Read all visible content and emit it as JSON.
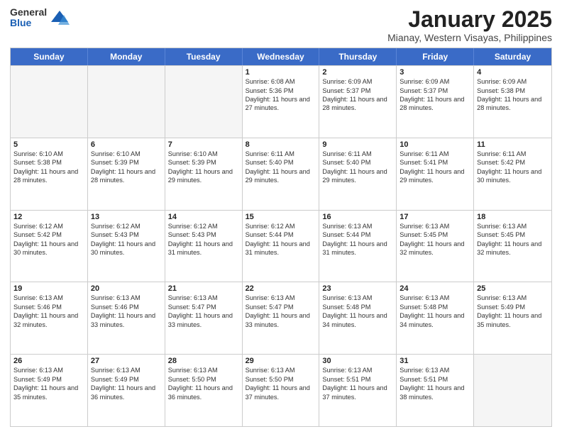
{
  "logo": {
    "general": "General",
    "blue": "Blue"
  },
  "header": {
    "month": "January 2025",
    "location": "Mianay, Western Visayas, Philippines"
  },
  "days": [
    "Sunday",
    "Monday",
    "Tuesday",
    "Wednesday",
    "Thursday",
    "Friday",
    "Saturday"
  ],
  "weeks": [
    [
      {
        "day": "",
        "empty": true
      },
      {
        "day": "",
        "empty": true
      },
      {
        "day": "",
        "empty": true
      },
      {
        "day": "1",
        "sunrise": "6:08 AM",
        "sunset": "5:36 PM",
        "daylight": "11 hours and 27 minutes."
      },
      {
        "day": "2",
        "sunrise": "6:09 AM",
        "sunset": "5:37 PM",
        "daylight": "11 hours and 28 minutes."
      },
      {
        "day": "3",
        "sunrise": "6:09 AM",
        "sunset": "5:37 PM",
        "daylight": "11 hours and 28 minutes."
      },
      {
        "day": "4",
        "sunrise": "6:09 AM",
        "sunset": "5:38 PM",
        "daylight": "11 hours and 28 minutes."
      }
    ],
    [
      {
        "day": "5",
        "sunrise": "6:10 AM",
        "sunset": "5:38 PM",
        "daylight": "11 hours and 28 minutes."
      },
      {
        "day": "6",
        "sunrise": "6:10 AM",
        "sunset": "5:39 PM",
        "daylight": "11 hours and 28 minutes."
      },
      {
        "day": "7",
        "sunrise": "6:10 AM",
        "sunset": "5:39 PM",
        "daylight": "11 hours and 29 minutes."
      },
      {
        "day": "8",
        "sunrise": "6:11 AM",
        "sunset": "5:40 PM",
        "daylight": "11 hours and 29 minutes."
      },
      {
        "day": "9",
        "sunrise": "6:11 AM",
        "sunset": "5:40 PM",
        "daylight": "11 hours and 29 minutes."
      },
      {
        "day": "10",
        "sunrise": "6:11 AM",
        "sunset": "5:41 PM",
        "daylight": "11 hours and 29 minutes."
      },
      {
        "day": "11",
        "sunrise": "6:11 AM",
        "sunset": "5:42 PM",
        "daylight": "11 hours and 30 minutes."
      }
    ],
    [
      {
        "day": "12",
        "sunrise": "6:12 AM",
        "sunset": "5:42 PM",
        "daylight": "11 hours and 30 minutes."
      },
      {
        "day": "13",
        "sunrise": "6:12 AM",
        "sunset": "5:43 PM",
        "daylight": "11 hours and 30 minutes."
      },
      {
        "day": "14",
        "sunrise": "6:12 AM",
        "sunset": "5:43 PM",
        "daylight": "11 hours and 31 minutes."
      },
      {
        "day": "15",
        "sunrise": "6:12 AM",
        "sunset": "5:44 PM",
        "daylight": "11 hours and 31 minutes."
      },
      {
        "day": "16",
        "sunrise": "6:13 AM",
        "sunset": "5:44 PM",
        "daylight": "11 hours and 31 minutes."
      },
      {
        "day": "17",
        "sunrise": "6:13 AM",
        "sunset": "5:45 PM",
        "daylight": "11 hours and 32 minutes."
      },
      {
        "day": "18",
        "sunrise": "6:13 AM",
        "sunset": "5:45 PM",
        "daylight": "11 hours and 32 minutes."
      }
    ],
    [
      {
        "day": "19",
        "sunrise": "6:13 AM",
        "sunset": "5:46 PM",
        "daylight": "11 hours and 32 minutes."
      },
      {
        "day": "20",
        "sunrise": "6:13 AM",
        "sunset": "5:46 PM",
        "daylight": "11 hours and 33 minutes."
      },
      {
        "day": "21",
        "sunrise": "6:13 AM",
        "sunset": "5:47 PM",
        "daylight": "11 hours and 33 minutes."
      },
      {
        "day": "22",
        "sunrise": "6:13 AM",
        "sunset": "5:47 PM",
        "daylight": "11 hours and 33 minutes."
      },
      {
        "day": "23",
        "sunrise": "6:13 AM",
        "sunset": "5:48 PM",
        "daylight": "11 hours and 34 minutes."
      },
      {
        "day": "24",
        "sunrise": "6:13 AM",
        "sunset": "5:48 PM",
        "daylight": "11 hours and 34 minutes."
      },
      {
        "day": "25",
        "sunrise": "6:13 AM",
        "sunset": "5:49 PM",
        "daylight": "11 hours and 35 minutes."
      }
    ],
    [
      {
        "day": "26",
        "sunrise": "6:13 AM",
        "sunset": "5:49 PM",
        "daylight": "11 hours and 35 minutes."
      },
      {
        "day": "27",
        "sunrise": "6:13 AM",
        "sunset": "5:49 PM",
        "daylight": "11 hours and 36 minutes."
      },
      {
        "day": "28",
        "sunrise": "6:13 AM",
        "sunset": "5:50 PM",
        "daylight": "11 hours and 36 minutes."
      },
      {
        "day": "29",
        "sunrise": "6:13 AM",
        "sunset": "5:50 PM",
        "daylight": "11 hours and 37 minutes."
      },
      {
        "day": "30",
        "sunrise": "6:13 AM",
        "sunset": "5:51 PM",
        "daylight": "11 hours and 37 minutes."
      },
      {
        "day": "31",
        "sunrise": "6:13 AM",
        "sunset": "5:51 PM",
        "daylight": "11 hours and 38 minutes."
      },
      {
        "day": "",
        "empty": true
      }
    ]
  ],
  "labels": {
    "sunrise": "Sunrise:",
    "sunset": "Sunset:",
    "daylight": "Daylight:"
  }
}
